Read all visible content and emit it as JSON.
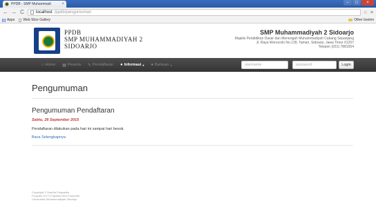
{
  "browser": {
    "tab_title": "PPDB - SMP Muhammadi",
    "tab_close": "×",
    "window_buttons": [
      "–",
      "□",
      "×"
    ],
    "url_host": "localhost",
    "url_path": "/ppdb/pengumuman",
    "bookmarks": {
      "apps": "Apps",
      "web_slice": "Web Slice Gallery",
      "other": "Other bookm"
    }
  },
  "header": {
    "brand_lines": [
      "PPDB",
      "SMP MUHAMMADIYAH 2",
      "SIDOARJO"
    ],
    "school_name": "SMP Muhammadiyah 2 Sidoarjo",
    "school_lines": [
      "Majelis Pendidikan Dasar dan Menengah Muhammadiyah Cabang Sepanjang",
      "Jl. Raya Wonocolo No.139, Taman, Sidoarjo, Jawa Timur 61257",
      "Telepon (031) 7881554"
    ]
  },
  "navbar": {
    "items": [
      {
        "label": "Home",
        "glyph": "⌂"
      },
      {
        "label": "Peserta",
        "glyph": "▦"
      },
      {
        "label": "Pendaftaran",
        "glyph": "✎"
      },
      {
        "label": "Informasi",
        "glyph": "●",
        "active": true,
        "caret": "▾"
      },
      {
        "label": "Bantuan",
        "glyph": "●",
        "caret": "▾"
      }
    ],
    "username_placeholder": "username",
    "password_placeholder": "password",
    "login_label": "Login"
  },
  "main": {
    "page_title": "Pengumuman",
    "post": {
      "title": "Pengumuman Pendaftaran",
      "date": "Sabtu, 26 September 2015",
      "body": "Pendaftaran dilakukan pada hari ini sampai hari besok.",
      "link": "Baca Selengkapnya"
    }
  },
  "footer": {
    "lines": [
      "Copyright © Hasrifa Puspadita",
      "Program D3 TI Fakultas Ilmu Komputer",
      "Universitas Muhammadiyah Sidoarjo"
    ]
  }
}
